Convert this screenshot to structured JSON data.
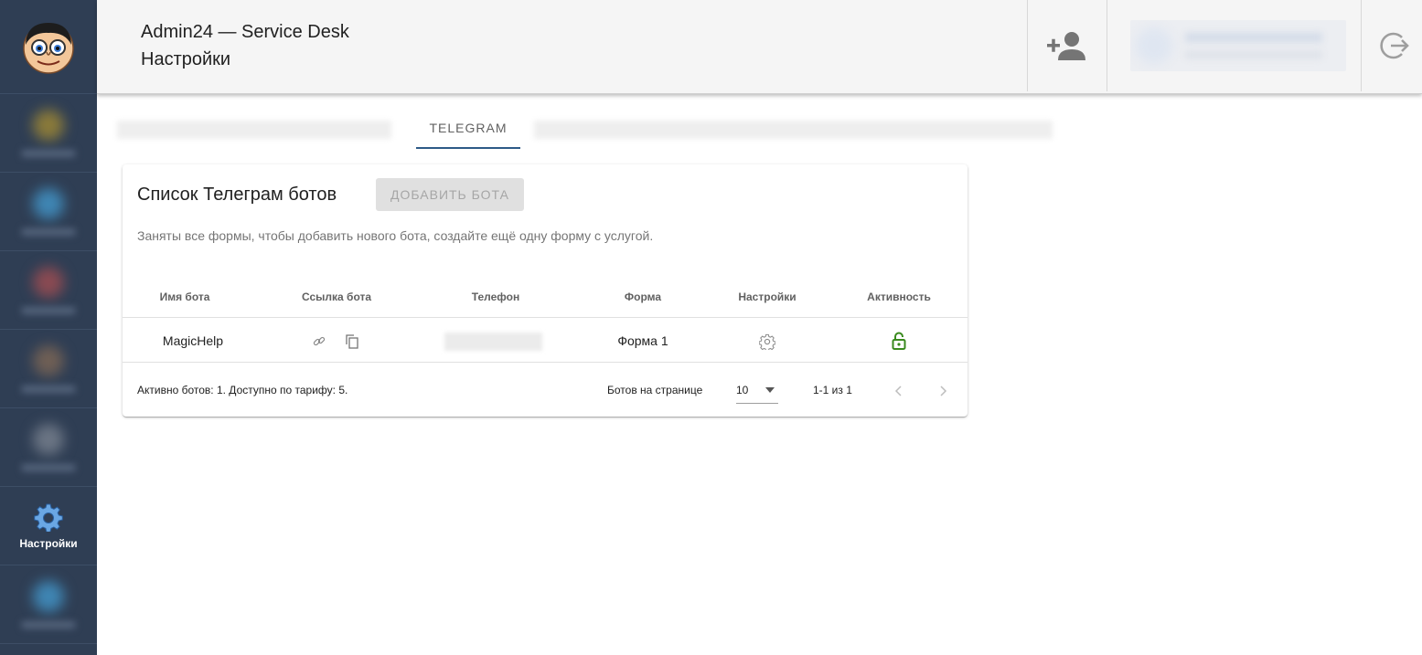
{
  "header": {
    "app_title": "Admin24 — Service Desk",
    "page_title": "Настройки"
  },
  "sidebar": {
    "active_item_label": "Настройки"
  },
  "tabs": {
    "active_tab_label": "TELEGRAM"
  },
  "card": {
    "title": "Список Телеграм ботов",
    "add_button_label": "ДОБАВИТЬ БОТА",
    "note": "Заняты все формы, чтобы добавить нового бота, создайте ещё одну форму с услугой.",
    "columns": [
      "Имя бота",
      "Ссылка бота",
      "Телефон",
      "Форма",
      "Настройки",
      "Активность"
    ],
    "rows": [
      {
        "name": "MagicHelp",
        "form": "Форма 1"
      }
    ],
    "footer": {
      "summary": "Активно ботов: 1. Доступно по тарифу: 5.",
      "per_page_label": "Ботов на странице",
      "per_page_value": "10",
      "range": "1-1 из 1"
    }
  },
  "colors": {
    "sidebar_bg": "#2f3e54",
    "tab_indicator": "#2d5a87",
    "active_lock": "#3a8a1e",
    "header_bg": "#f5f5f5"
  },
  "icons": [
    "avatar-logo",
    "gear-icon",
    "add-user-icon",
    "logout-icon",
    "link-icon",
    "copy-icon",
    "settings-gear-icon",
    "unlock-icon",
    "chevron-left-icon",
    "chevron-right-icon",
    "caret-down-icon"
  ]
}
